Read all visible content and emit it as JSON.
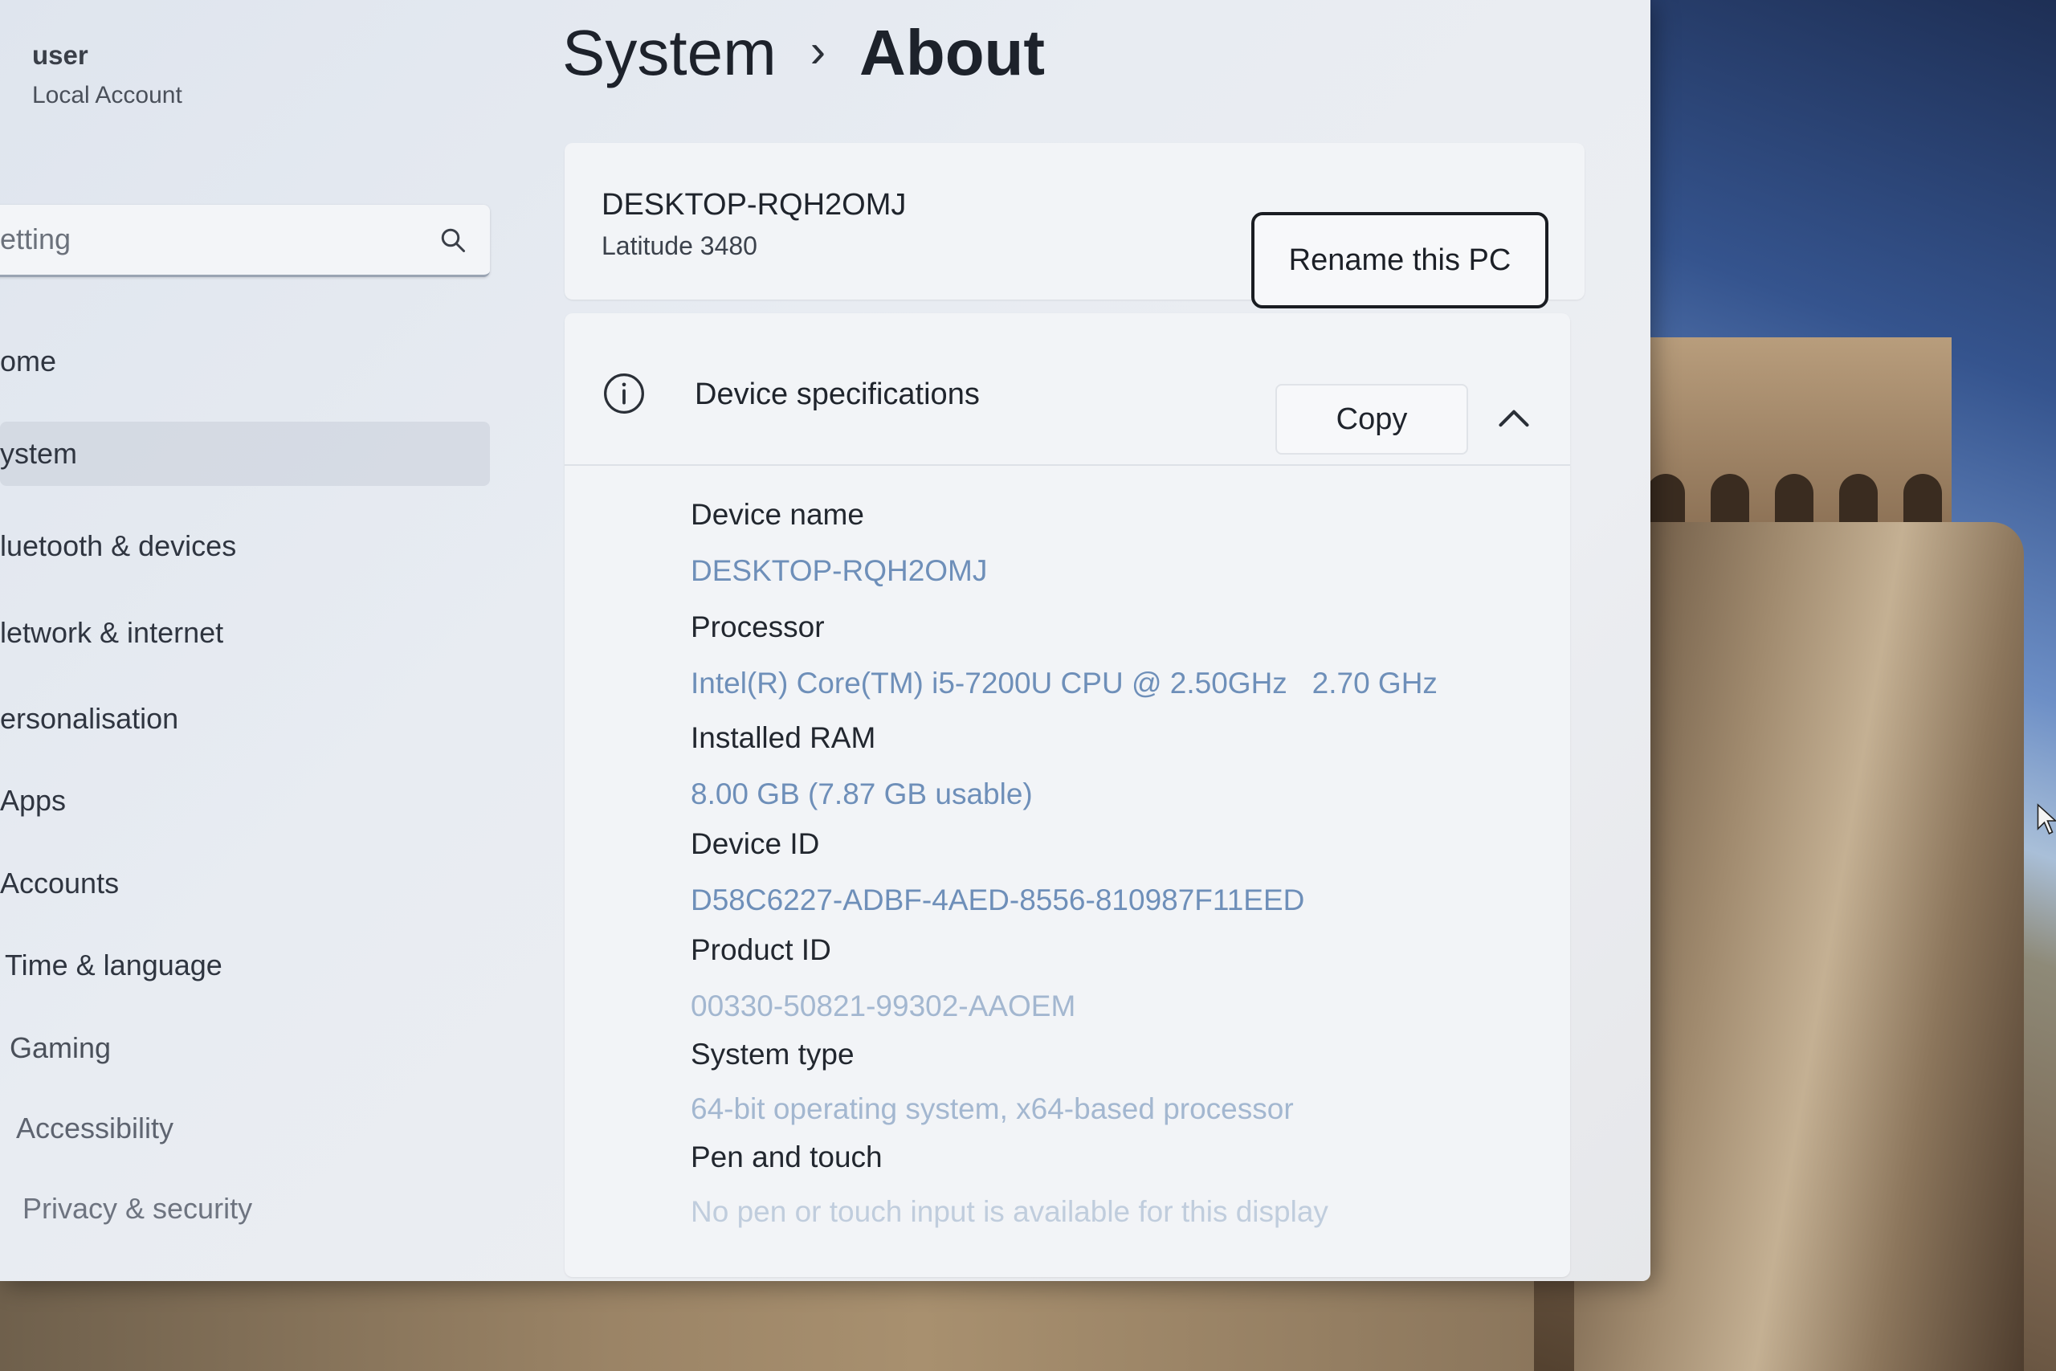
{
  "user": {
    "name": "user",
    "account_type": "Local Account"
  },
  "search": {
    "text": "etting"
  },
  "sidebar": {
    "items": [
      {
        "label": "ome"
      },
      {
        "label": "ystem"
      },
      {
        "label": "luetooth & devices"
      },
      {
        "label": "letwork & internet"
      },
      {
        "label": "ersonalisation"
      },
      {
        "label": "Apps"
      },
      {
        "label": "Accounts"
      },
      {
        "label": "Time & language"
      },
      {
        "label": "Gaming"
      },
      {
        "label": "Accessibility"
      },
      {
        "label": "Privacy & security"
      }
    ]
  },
  "breadcrumb": {
    "parent": "System",
    "separator": "›",
    "current": "About"
  },
  "pc": {
    "name": "DESKTOP-RQH2OMJ",
    "model": "Latitude 3480",
    "rename_label": "Rename this PC"
  },
  "specs": {
    "title": "Device specifications",
    "copy_label": "Copy",
    "rows": [
      {
        "label": "Device name",
        "value": "DESKTOP-RQH2OMJ"
      },
      {
        "label": "Processor",
        "value": "Intel(R) Core(TM) i5-7200U CPU @ 2.50GHz   2.70 GHz"
      },
      {
        "label": "Installed RAM",
        "value": "8.00 GB (7.87 GB usable)"
      },
      {
        "label": "Device ID",
        "value": "D58C6227-ADBF-4AED-8556-810987F11EED"
      },
      {
        "label": "Product ID",
        "value": "00330-50821-99302-AAOEM"
      },
      {
        "label": "System type",
        "value": "64-bit operating system, x64-based processor"
      },
      {
        "label": "Pen and touch",
        "value": "No pen or touch input is available for this display"
      }
    ]
  },
  "colors": {
    "accent_text": "#6e8fb9",
    "window_bg": "#e8ecf2",
    "card_bg": "#f2f4f7"
  }
}
